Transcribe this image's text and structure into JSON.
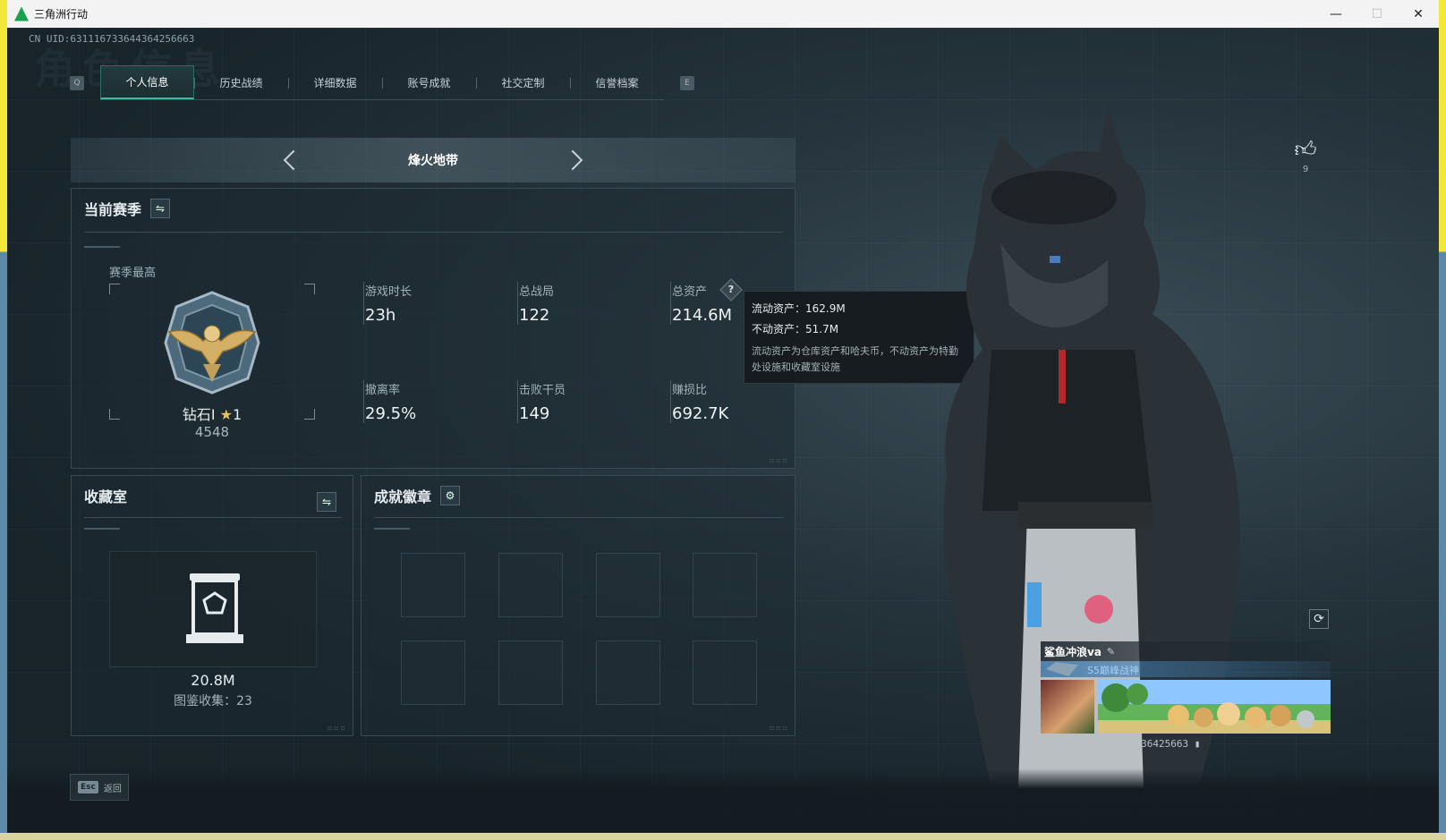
{
  "window": {
    "title": "三角洲行动",
    "minimize": "—",
    "maximize": "☐",
    "close": "✕"
  },
  "uid": "CN UID:631116733644364256663",
  "bg_title": "角色信息",
  "tabs": {
    "left_key": "Q",
    "right_key": "E",
    "items": [
      "个人信息",
      "历史战绩",
      "详细数据",
      "账号成就",
      "社交定制",
      "信誉档案"
    ],
    "active": 0
  },
  "mode": {
    "title": "烽火地带"
  },
  "season": {
    "title": "当前赛季",
    "best_label": "赛季最高",
    "rank_name": "钻石Ⅰ",
    "rank_star": "★",
    "rank_stars_count": "1",
    "rank_points": "4548",
    "stats": [
      {
        "label": "游戏时长",
        "value": "23h"
      },
      {
        "label": "总战局",
        "value": "122"
      },
      {
        "label": "总资产",
        "value": "214.6M"
      },
      {
        "label": "撤离率",
        "value": "29.5%"
      },
      {
        "label": "击败干员",
        "value": "149"
      },
      {
        "label": "赚损比",
        "value": "692.7K"
      }
    ],
    "help": "?"
  },
  "tooltip": {
    "liquid": "流动资产：162.9M",
    "fixed": "不动资产：51.7M",
    "desc": "流动资产为仓库资产和哈夫币，不动资产为特勤处设施和收藏室设施"
  },
  "collection": {
    "title": "收藏室",
    "value": "20.8M",
    "count": "图鉴收集：23"
  },
  "achievement": {
    "title": "成就徽章",
    "slots": 8
  },
  "like": {
    "count": "9"
  },
  "card": {
    "name": "鲨鱼冲浪va",
    "title": "S5巅峰战神",
    "id": "编号 63111673364436425663"
  },
  "footer": {
    "esc_key": "Esc",
    "esc_label": "返回"
  },
  "colors": {
    "accent": "#3fb8a0",
    "bg": "#1a252c",
    "panel_border": "#3a4a52"
  }
}
